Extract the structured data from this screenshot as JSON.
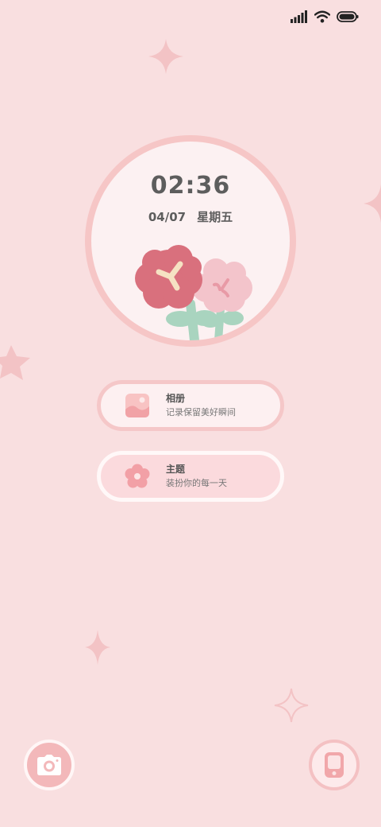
{
  "status_bar": {
    "signal_icon": "signal-bars-icon",
    "wifi_icon": "wifi-icon",
    "battery_icon": "battery-icon",
    "battery_level": 1.0
  },
  "clock_widget": {
    "time": "02:36",
    "date": "04/07",
    "weekday": "星期五",
    "illustration": "flower-bouquet-illustration"
  },
  "cards": [
    {
      "title": "相册",
      "subtitle": "记录保留美好瞬间",
      "icon": "gallery-icon"
    },
    {
      "title": "主题",
      "subtitle": "装扮你的每一天",
      "icon": "flower-icon"
    }
  ],
  "dock": {
    "left_icon": "camera-icon",
    "right_icon": "phone-icon"
  },
  "colors": {
    "background": "#f9dfe0",
    "accent": "#f3b8ba",
    "text": "#5d5d5d"
  }
}
